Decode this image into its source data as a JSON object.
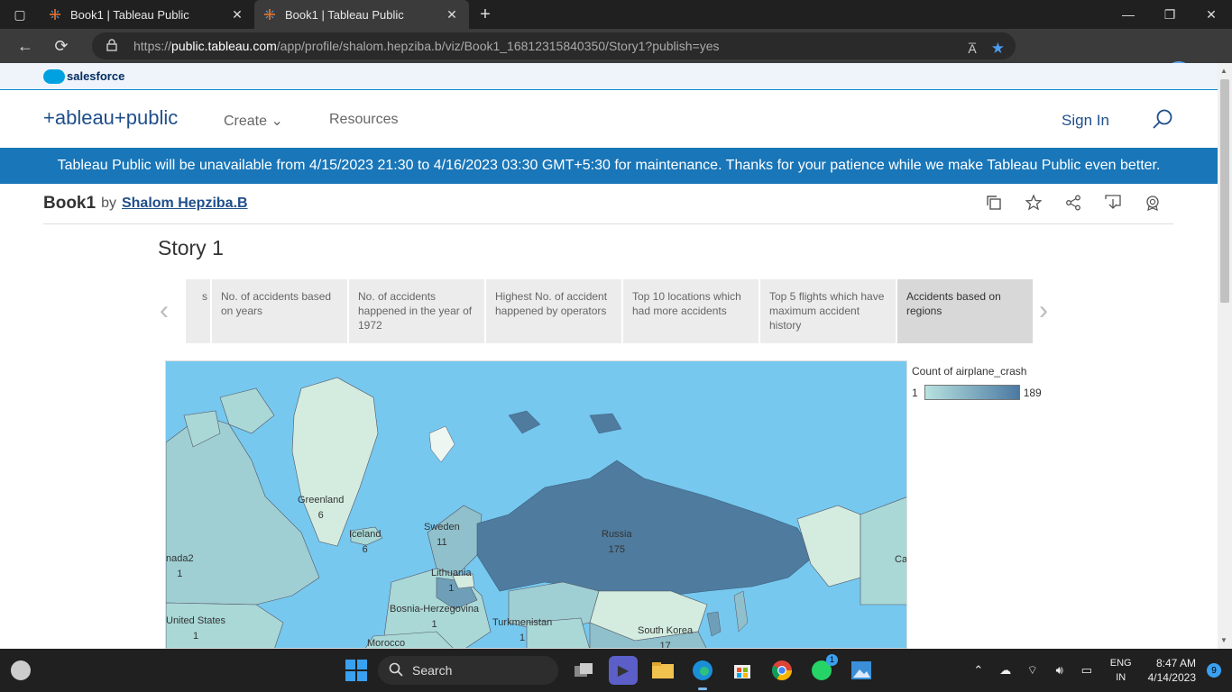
{
  "browser": {
    "tabs": [
      {
        "title": "Book1 | Tableau Public",
        "active": false
      },
      {
        "title": "Book1 | Tableau Public",
        "active": true
      }
    ],
    "url_domain": "public.tableau.com",
    "url_prefix": "https://",
    "url_path": "/app/profile/shalom.hepziba.b/viz/Book1_16812315840350/Story1?publish=yes",
    "read_aloud": "A̅",
    "bing_label": "b"
  },
  "salesforce": {
    "label": "salesforce"
  },
  "header": {
    "logo": "+ableau+public",
    "nav": {
      "create": "Create",
      "resources": "Resources"
    },
    "sign_in": "Sign In"
  },
  "banner": {
    "text": "Tableau Public will be unavailable from 4/15/2023 21:30 to 4/16/2023 03:30 GMT+5:30 for maintenance. Thanks for your patience while we make Tableau Public even better."
  },
  "book": {
    "title": "Book1",
    "by": "by",
    "author": "Shalom Hepziba.B"
  },
  "story": {
    "title": "Story 1",
    "points": [
      {
        "label": "s",
        "active": false
      },
      {
        "label": "No. of accidents based on years",
        "active": false
      },
      {
        "label": "No. of accidents happened in the year of 1972",
        "active": false
      },
      {
        "label": "Highest No. of accident happened by operators",
        "active": false
      },
      {
        "label": "Top 10 locations which had more accidents",
        "active": false
      },
      {
        "label": "Top 5 flights which have maximum accident history",
        "active": false
      },
      {
        "label": "Accidents based on regions",
        "active": true
      }
    ]
  },
  "map": {
    "labels": [
      {
        "name": "Greenland",
        "value": "6"
      },
      {
        "name": "Iceland",
        "value": "6"
      },
      {
        "name": "Sweden",
        "value": "11"
      },
      {
        "name": "Russia",
        "value": "175"
      },
      {
        "name": "nada2",
        "value": "1"
      },
      {
        "name": "Lithuania",
        "value": "1"
      },
      {
        "name": "Bosnia-Herzegovina",
        "value": "1"
      },
      {
        "name": "Turkmenistan",
        "value": "1"
      },
      {
        "name": "United States",
        "value": "1"
      },
      {
        "name": "South Korea",
        "value": "17"
      },
      {
        "name": "Morocco",
        "value": ""
      },
      {
        "name": "Ca",
        "value": ""
      }
    ],
    "colors": {
      "ocean": "#76c8ef",
      "low": "#b7e2e0",
      "high": "#4b79a2"
    }
  },
  "legend": {
    "title": "Count of airplane_crash",
    "min": "1",
    "max": "189"
  },
  "taskbar": {
    "search": "Search",
    "lang_top": "ENG",
    "lang_bottom": "IN",
    "time": "8:47 AM",
    "date": "4/14/2023",
    "notifications": "9",
    "whatsapp_badge": "1"
  }
}
